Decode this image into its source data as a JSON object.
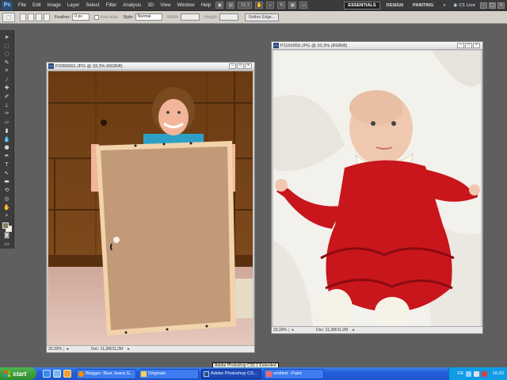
{
  "menubar": {
    "logo": "Ps",
    "items": [
      "File",
      "Edit",
      "Image",
      "Layer",
      "Select",
      "Filter",
      "Analysis",
      "3D",
      "View",
      "Window",
      "Help"
    ],
    "zoom": "33,3",
    "workspaces": [
      {
        "label": "ESSENTIALS",
        "active": true
      },
      {
        "label": "DESIGN",
        "active": false
      },
      {
        "label": "PAINTING",
        "active": false
      }
    ],
    "more": "»",
    "cs_live": "CS Live"
  },
  "options": {
    "feather_label": "Feather:",
    "feather_value": "0 px",
    "antialias_label": "Anti-alias",
    "style_label": "Style:",
    "style_value": "Normal",
    "width_label": "Width:",
    "height_label": "Height:",
    "refine_edge": "Refine Edge..."
  },
  "doc_left": {
    "title": "P2050062.JPG @ 33,3% (RGB/8)",
    "zoom": "33,33%",
    "info": "Doc: 11,2M/11,2M"
  },
  "doc_right": {
    "title": "P1150059.JPG @ 33,3% (RGB/8)",
    "zoom": "33,33%",
    "info": "Doc: 11,2M/11,2M"
  },
  "taskbar": {
    "start": "start",
    "tasks": [
      {
        "label": "Blogger: Blue Jeans G...",
        "color": "#ff8a00",
        "active": false
      },
      {
        "label": "Originals",
        "color": "#f4d35e",
        "active": false
      },
      {
        "label": "Adobe Photoshop CS...",
        "color": "#2b4e7a",
        "active": true
      },
      {
        "label": "untitled - Paint",
        "color": "#f06a6a",
        "active": false
      }
    ],
    "tooltip": "Adobe Photoshop CS5.1 Extended",
    "lang": "DE",
    "clock": "16:20"
  },
  "colors": {
    "foreground": "#8b7b60",
    "background": "#f4f0e6"
  }
}
